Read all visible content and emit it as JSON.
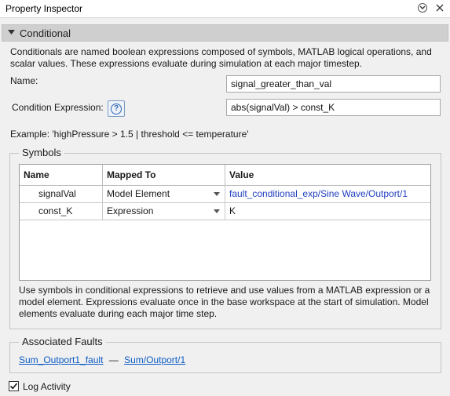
{
  "panel": {
    "title": "Property Inspector"
  },
  "section": {
    "label": "Conditional",
    "description": "Conditionals are named boolean expressions composed of symbols, MATLAB logical operations, and scalar values. These expressions evaluate during simulation at each major timestep."
  },
  "form": {
    "name_label": "Name:",
    "name_value": "signal_greater_than_val",
    "condition_label": "Condition Expression:",
    "condition_value": "abs(signalVal) > const_K",
    "help_glyph": "?",
    "example": "Example: 'highPressure > 1.5 | threshold <= temperature'"
  },
  "symbols": {
    "group_title": "Symbols",
    "columns": [
      "Name",
      "Mapped To",
      "Value"
    ],
    "rows": [
      {
        "name": "signalVal",
        "mapped_to": "Model Element",
        "value": "fault_conditional_exp/Sine Wave/Outport/1"
      },
      {
        "name": "const_K",
        "mapped_to": "Expression",
        "value": "K"
      }
    ],
    "note": "Use symbols in conditional expressions to retrieve and use values from a MATLAB expression or a model element. Expressions evaluate once in the base workspace at the start of simulation. Model elements evaluate during each major time step."
  },
  "faults": {
    "group_title": "Associated Faults",
    "fault_link": "Sum_Outport1_fault",
    "separator": "—",
    "port_link": "Sum/Outport/1"
  },
  "log_activity": {
    "label": "Log Activity",
    "checked": true
  },
  "icons": {
    "menu": "circle-chevron-down-icon",
    "close": "close-icon",
    "collapse": "triangle-down-icon",
    "help": "question-mark-icon",
    "dropdown": "dropdown-arrow-icon",
    "check": "checkmark-icon"
  },
  "colors": {
    "link": "#0b5bc4",
    "model_element_value": "#1f3fbf",
    "section_header": "#cfcfcf"
  }
}
